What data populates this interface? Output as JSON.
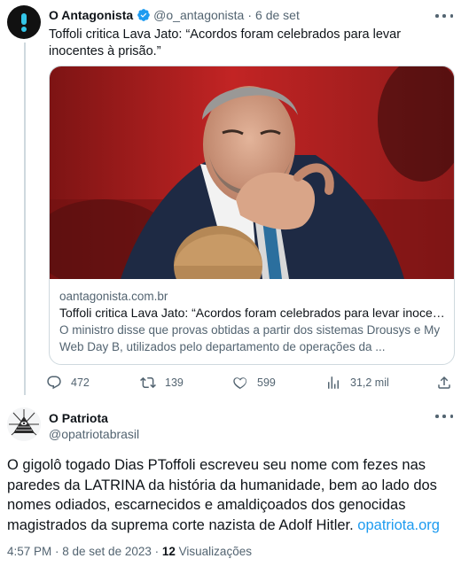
{
  "quoted_tweet": {
    "display_name": "O Antagonista",
    "handle": "@o_antagonista",
    "separator": "·",
    "date": "6 de set",
    "text": "Toffoli critica Lava Jato: “Acordos foram celebrados para levar inocentes à prisão.”",
    "card": {
      "domain": "oantagonista.com.br",
      "title": "Toffoli critica Lava Jato: “Acordos foram celebrados para levar inocentes à prisão.”",
      "description": "O ministro disse que provas obtidas a partir dos sistemas Drousys e My Web Day B, utilizados pelo departamento de operações da ..."
    },
    "actions": {
      "replies": "472",
      "retweets": "139",
      "likes": "599",
      "views": "31,2 mil"
    },
    "icons": [
      "verified-icon",
      "more-icon",
      "reply-icon",
      "retweet-icon",
      "like-icon",
      "views-icon",
      "share-icon"
    ]
  },
  "main_tweet": {
    "display_name": "O Patriota",
    "handle": "@opatriotabrasil",
    "text_body": "O gigolô togado Dias PToffoli escreveu seu nome com fezes nas paredes da LATRINA da história da humanidade, bem ao lado dos nomes odiados, escarnecidos e amaldiçoados dos genocidas magistrados da suprema corte nazista de Adolf Hitler.",
    "link": "opatriota.org",
    "timestamp": "4:57 PM · 8 de set de 2023 · ",
    "views_count": "12",
    "views_label": "Visualizações"
  },
  "colors": {
    "text": "#0f1419",
    "muted": "#536471",
    "link": "#1d9bf0",
    "verified": "#1d9bf0",
    "border": "#cfd9de"
  }
}
